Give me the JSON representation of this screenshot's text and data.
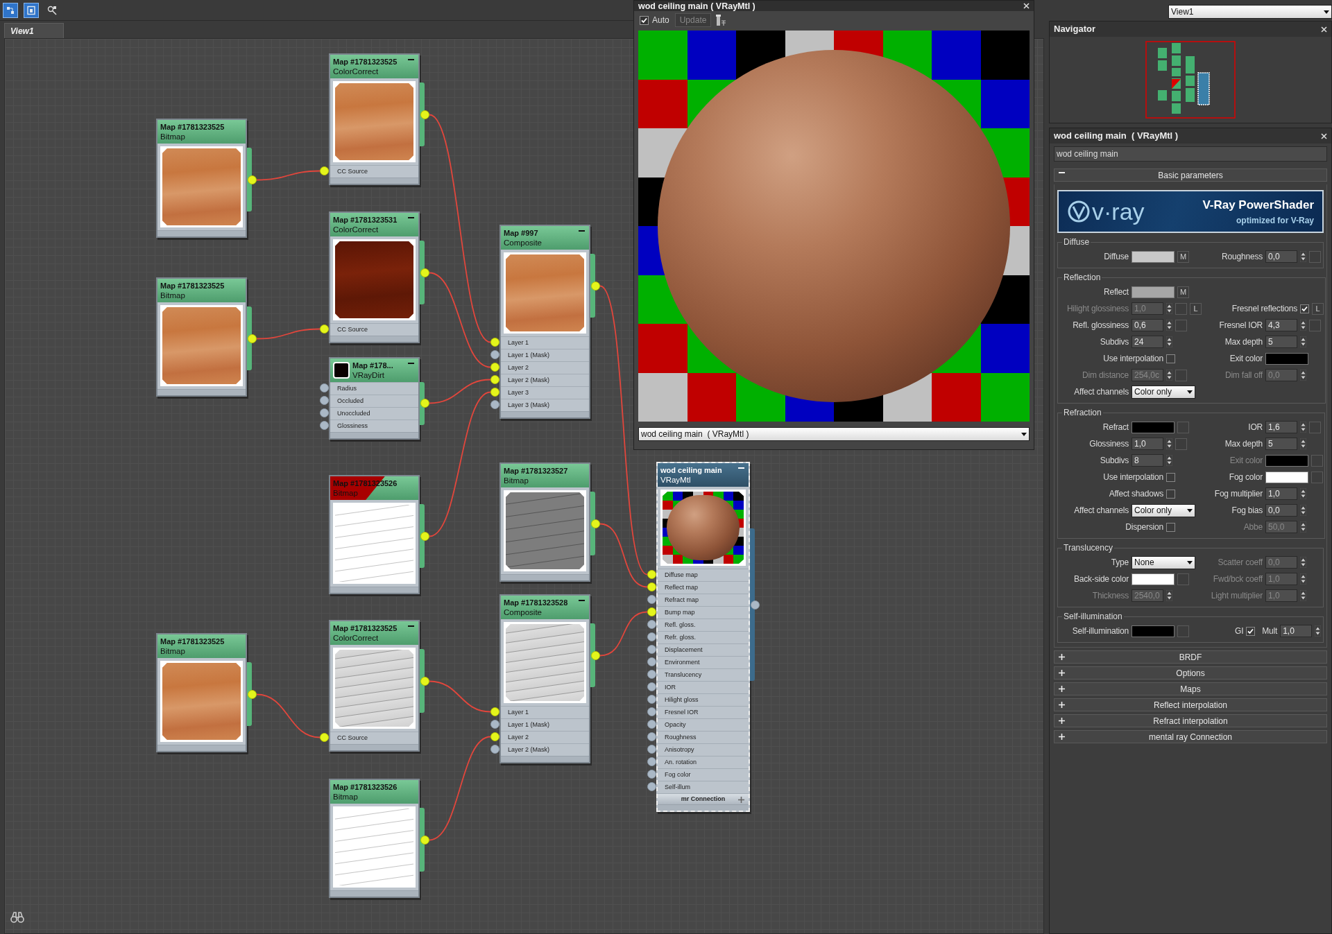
{
  "toolbar": {
    "tools": [
      {
        "selected": true
      },
      {
        "selected": true
      },
      {
        "selected": false
      }
    ]
  },
  "view_tabs": [
    {
      "label": "View1",
      "selected": true
    }
  ],
  "view_selector": {
    "value": "View1"
  },
  "node_editor": {
    "nodes": [
      {
        "name": "Map #1781323525",
        "type": "ColorCorrect",
        "kind": "map",
        "selected": false,
        "minimize_button": true,
        "flagged": false,
        "preview": {
          "kind": "wood"
        },
        "rows": [
          {
            "label": "CC Source",
            "connected": true
          }
        ],
        "output_connected": true
      },
      {
        "name": "Map #1781323525",
        "type": "Bitmap",
        "kind": "map",
        "selected": false,
        "minimize_button": false,
        "flagged": false,
        "preview": {
          "kind": "wood"
        },
        "output_connected": true
      },
      {
        "name": "Map #1781323531",
        "type": "ColorCorrect",
        "kind": "map",
        "selected": false,
        "minimize_button": true,
        "flagged": false,
        "preview": {
          "kind": "dark-wood"
        },
        "rows": [
          {
            "label": "CC Source",
            "connected": true
          }
        ],
        "output_connected": true
      },
      {
        "name": "Map #997",
        "type": "Composite",
        "kind": "map",
        "selected": false,
        "minimize_button": true,
        "flagged": false,
        "preview": {
          "kind": "wood"
        },
        "rows": [
          {
            "label": "Layer 1",
            "connected": true
          },
          {
            "label": "Layer 1 (Mask)",
            "connected": false
          },
          {
            "label": "Layer 2",
            "connected": true
          },
          {
            "label": "Layer 2 (Mask)",
            "connected": true
          },
          {
            "label": "Layer 3",
            "connected": true
          },
          {
            "label": "Layer 3 (Mask)",
            "connected": false
          }
        ],
        "output_connected": true
      },
      {
        "name": "Map #1781323525",
        "type": "Bitmap",
        "kind": "map",
        "selected": false,
        "minimize_button": false,
        "flagged": false,
        "preview": {
          "kind": "wood"
        },
        "output_connected": true
      },
      {
        "name": "Map #178...",
        "type": "VRayDirt",
        "kind": "map",
        "selected": false,
        "minimize_button": true,
        "flagged": false,
        "header_swatch": {
          "kind": "black"
        },
        "rows": [
          {
            "label": "Radius",
            "connected": false
          },
          {
            "label": "Occluded",
            "connected": false
          },
          {
            "label": "Unoccluded",
            "connected": false
          },
          {
            "label": "Glossiness",
            "connected": false
          }
        ],
        "output_connected": true
      },
      {
        "name": "Map #1781323527",
        "type": "Bitmap",
        "kind": "map",
        "selected": false,
        "minimize_button": false,
        "flagged": false,
        "preview": {
          "kind": "gray-grain"
        },
        "output_connected": true
      },
      {
        "name": "wod ceiling main",
        "type": "VRayMtl",
        "kind": "material",
        "selected": true,
        "minimize_button": true,
        "flagged": false,
        "preview": {
          "kind": "render"
        },
        "rows": [
          {
            "label": "Diffuse map",
            "connected": true
          },
          {
            "label": "Reflect map",
            "connected": true
          },
          {
            "label": "Refract map",
            "connected": false
          },
          {
            "label": "Bump map",
            "connected": true
          },
          {
            "label": "Refl. gloss.",
            "connected": false
          },
          {
            "label": "Refr. gloss.",
            "connected": false
          },
          {
            "label": "Displacement",
            "connected": false
          },
          {
            "label": "Environment",
            "connected": false
          },
          {
            "label": "Translucency",
            "connected": false
          },
          {
            "label": "IOR",
            "connected": false
          },
          {
            "label": "Hilight gloss",
            "connected": false
          },
          {
            "label": "Fresnel IOR",
            "connected": false
          },
          {
            "label": "Opacity",
            "connected": false
          },
          {
            "label": "Roughness",
            "connected": false
          },
          {
            "label": "Anisotropy",
            "connected": false
          },
          {
            "label": "An. rotation",
            "connected": false
          },
          {
            "label": "Fog color",
            "connected": false
          },
          {
            "label": "Self-illum",
            "connected": false
          }
        ],
        "footer": "mr Connection",
        "output_connected": false
      },
      {
        "name": "Map #1781323526",
        "type": "Bitmap",
        "kind": "map",
        "selected": false,
        "minimize_button": false,
        "flagged": true,
        "preview": {
          "kind": "white-grain"
        },
        "output_connected": true
      },
      {
        "name": "Map #1781323528",
        "type": "Composite",
        "kind": "map",
        "selected": false,
        "minimize_button": true,
        "flagged": false,
        "preview": {
          "kind": "light-grain"
        },
        "rows": [
          {
            "label": "Layer 1",
            "connected": true
          },
          {
            "label": "Layer 1 (Mask)",
            "connected": false
          },
          {
            "label": "Layer 2",
            "connected": true
          },
          {
            "label": "Layer 2 (Mask)",
            "connected": false
          }
        ],
        "output_connected": true
      },
      {
        "name": "Map #1781323525",
        "type": "ColorCorrect",
        "kind": "map",
        "selected": false,
        "minimize_button": true,
        "flagged": false,
        "preview": {
          "kind": "light-grain"
        },
        "rows": [
          {
            "label": "CC Source",
            "connected": true
          }
        ],
        "output_connected": true
      },
      {
        "name": "Map #1781323525",
        "type": "Bitmap",
        "kind": "map",
        "selected": false,
        "minimize_button": false,
        "flagged": false,
        "preview": {
          "kind": "wood"
        },
        "output_connected": true
      },
      {
        "name": "Map #1781323526",
        "type": "Bitmap",
        "kind": "map",
        "selected": false,
        "minimize_button": false,
        "flagged": false,
        "preview": {
          "kind": "white-grain"
        },
        "output_connected": true
      }
    ]
  },
  "preview_window": {
    "title": "wod ceiling main  ( VRayMtl )",
    "auto": {
      "label": "Auto",
      "checked": true
    },
    "update_button": {
      "label": "Update",
      "disabled": true
    },
    "material_dropdown": {
      "value": "wod ceiling main  ( VRayMtl )"
    }
  },
  "navigator": {
    "title": "Navigator"
  },
  "material_panel": {
    "title": "wod ceiling main  ( VRayMtl )",
    "name_field": {
      "value": "wod ceiling main"
    },
    "rollouts": [
      {
        "title": "Basic parameters",
        "expanded": true,
        "banner": {
          "logo": "v·ray",
          "title": "V-Ray PowerShader",
          "subtitle": "optimized for V-Ray"
        },
        "groups": [
          {
            "title": "Diffuse",
            "rows": [
              {
                "left": [
                  {
                    "label": "Diffuse",
                    "kind": "color",
                    "color": "#c8c8c8",
                    "button": "M"
                  }
                ],
                "right": [
                  {
                    "label": "Roughness",
                    "kind": "spinner",
                    "value": "0,0",
                    "slot": true
                  }
                ]
              }
            ]
          },
          {
            "title": "Reflection",
            "rows": [
              {
                "left": [
                  {
                    "label": "Reflect",
                    "kind": "color",
                    "color": "#a6a6a6",
                    "button": "M"
                  }
                ]
              },
              {
                "left": [
                  {
                    "label": "Hilight glossiness",
                    "kind": "spinner",
                    "value": "1,0",
                    "disabled": true,
                    "slot": true,
                    "button": "L"
                  }
                ],
                "right": [
                  {
                    "label": "Fresnel reflections",
                    "kind": "checkbox",
                    "checked": true,
                    "button": "L"
                  }
                ]
              },
              {
                "left": [
                  {
                    "label": "Refl. glossiness",
                    "kind": "spinner",
                    "value": "0,6",
                    "slot": true
                  }
                ],
                "right": [
                  {
                    "label": "Fresnel IOR",
                    "kind": "spinner",
                    "value": "4,3",
                    "slot": true
                  }
                ]
              },
              {
                "left": [
                  {
                    "label": "Subdivs",
                    "kind": "spinner",
                    "value": "24"
                  }
                ],
                "right": [
                  {
                    "label": "Max depth",
                    "kind": "spinner",
                    "value": "5"
                  }
                ]
              },
              {
                "left": [
                  {
                    "label": "Use interpolation",
                    "kind": "checkbox",
                    "checked": false
                  }
                ],
                "right": [
                  {
                    "label": "Exit color",
                    "kind": "color",
                    "color": "#000000"
                  }
                ]
              },
              {
                "left": [
                  {
                    "label": "Dim distance",
                    "kind": "spinner",
                    "value": "254,0c",
                    "disabled": true,
                    "slot": true
                  }
                ],
                "right": [
                  {
                    "label": "Dim fall off",
                    "kind": "spinner",
                    "value": "0,0",
                    "disabled": true
                  }
                ]
              },
              {
                "left": [
                  {
                    "label": "Affect channels",
                    "kind": "dropdown",
                    "value": "Color only"
                  }
                ]
              }
            ]
          },
          {
            "title": "Refraction",
            "rows": [
              {
                "left": [
                  {
                    "label": "Refract",
                    "kind": "color",
                    "color": "#000000",
                    "slot": true
                  }
                ],
                "right": [
                  {
                    "label": "IOR",
                    "kind": "spinner",
                    "value": "1,6",
                    "slot": true
                  }
                ]
              },
              {
                "left": [
                  {
                    "label": "Glossiness",
                    "kind": "spinner",
                    "value": "1,0",
                    "slot": true
                  }
                ],
                "right": [
                  {
                    "label": "Max depth",
                    "kind": "spinner",
                    "value": "5"
                  }
                ]
              },
              {
                "left": [
                  {
                    "label": "Subdivs",
                    "kind": "spinner",
                    "value": "8"
                  }
                ],
                "right": [
                  {
                    "label": "Exit color",
                    "kind": "color",
                    "color": "#000000",
                    "disabled": true,
                    "slot": true
                  }
                ]
              },
              {
                "left": [
                  {
                    "label": "Use interpolation",
                    "kind": "checkbox",
                    "checked": false
                  }
                ],
                "right": [
                  {
                    "label": "Fog color",
                    "kind": "color",
                    "color": "#ffffff",
                    "slot": true
                  }
                ]
              },
              {
                "left": [
                  {
                    "label": "Affect shadows",
                    "kind": "checkbox",
                    "checked": false
                  }
                ],
                "right": [
                  {
                    "label": "Fog multiplier",
                    "kind": "spinner",
                    "value": "1,0"
                  }
                ]
              },
              {
                "left": [
                  {
                    "label": "Affect channels",
                    "kind": "dropdown",
                    "value": "Color only"
                  }
                ],
                "right": [
                  {
                    "label": "Fog bias",
                    "kind": "spinner",
                    "value": "0,0"
                  }
                ]
              },
              {
                "left": [
                  {
                    "label": "Dispersion",
                    "kind": "checkbox",
                    "checked": false
                  }
                ],
                "right": [
                  {
                    "label": "Abbe",
                    "kind": "spinner",
                    "value": "50,0",
                    "disabled": true
                  }
                ]
              }
            ]
          },
          {
            "title": "Translucency",
            "rows": [
              {
                "left": [
                  {
                    "label": "Type",
                    "kind": "dropdown",
                    "value": "None"
                  }
                ],
                "right": [
                  {
                    "label": "Scatter coeff",
                    "kind": "spinner",
                    "value": "0,0",
                    "disabled": true
                  }
                ]
              },
              {
                "left": [
                  {
                    "label": "Back-side color",
                    "kind": "color",
                    "color": "#ffffff",
                    "slot": true
                  }
                ],
                "right": [
                  {
                    "label": "Fwd/bck coeff",
                    "kind": "spinner",
                    "value": "1,0",
                    "disabled": true
                  }
                ]
              },
              {
                "left": [
                  {
                    "label": "Thickness",
                    "kind": "spinner",
                    "value": "2540,0",
                    "disabled": true
                  }
                ],
                "right": [
                  {
                    "label": "Light multiplier",
                    "kind": "spinner",
                    "value": "1,0",
                    "disabled": true
                  }
                ]
              }
            ]
          },
          {
            "title": "Self-illumination",
            "rows": [
              {
                "left": [
                  {
                    "label": "Self-illumination",
                    "kind": "color",
                    "color": "#000000",
                    "slot": true
                  }
                ],
                "right": [
                  {
                    "label": "GI",
                    "kind": "checkbox",
                    "checked": true
                  },
                  {
                    "label": "Mult",
                    "kind": "spinner",
                    "value": "1,0"
                  }
                ]
              }
            ]
          }
        ]
      },
      {
        "title": "BRDF",
        "expanded": false
      },
      {
        "title": "Options",
        "expanded": false
      },
      {
        "title": "Maps",
        "expanded": false
      },
      {
        "title": "Reflect interpolation",
        "expanded": false
      },
      {
        "title": "Refract interpolation",
        "expanded": false
      },
      {
        "title": "mental ray Connection",
        "expanded": false
      }
    ]
  }
}
